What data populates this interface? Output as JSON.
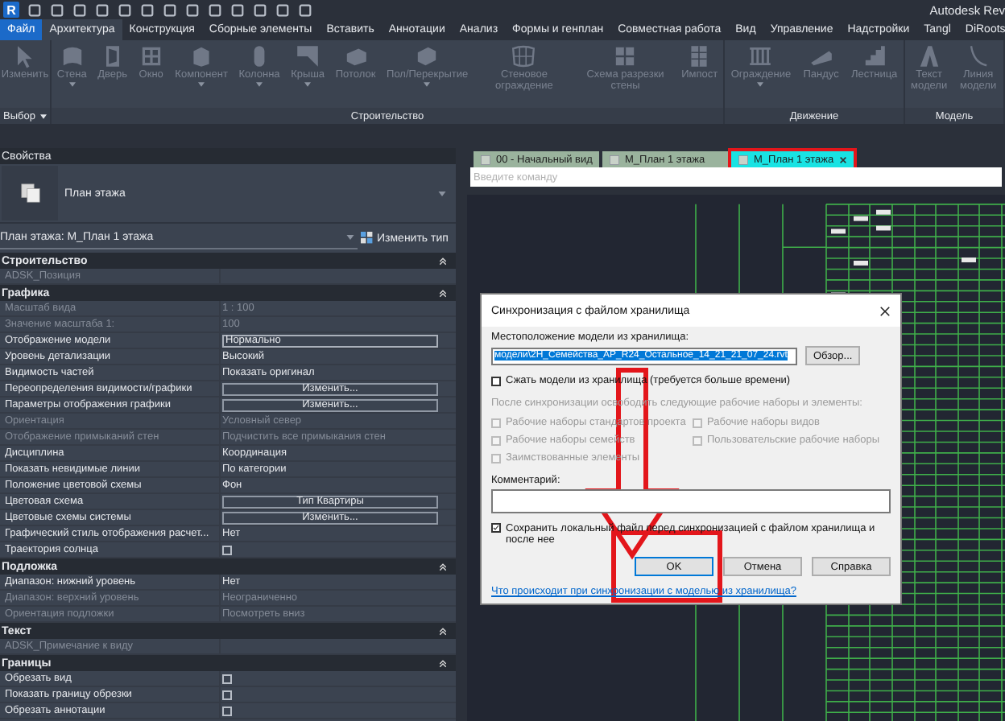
{
  "app": {
    "logo": "R",
    "title": "Autodesk Rev"
  },
  "ribbon_tabs": [
    {
      "label": "Файл",
      "kind": "menu",
      "selected": false
    },
    {
      "label": "Архитектура",
      "kind": "tab",
      "selected": true
    },
    {
      "label": "Конструкция",
      "kind": "tab",
      "selected": false
    },
    {
      "label": "Сборные элементы",
      "kind": "tab",
      "selected": false
    },
    {
      "label": "Вставить",
      "kind": "tab",
      "selected": false
    },
    {
      "label": "Аннотации",
      "kind": "tab",
      "selected": false
    },
    {
      "label": "Анализ",
      "kind": "tab",
      "selected": false
    },
    {
      "label": "Формы и генплан",
      "kind": "tab",
      "selected": false
    },
    {
      "label": "Совместная работа",
      "kind": "tab",
      "selected": false
    },
    {
      "label": "Вид",
      "kind": "tab",
      "selected": false
    },
    {
      "label": "Управление",
      "kind": "tab",
      "selected": false
    },
    {
      "label": "Надстройки",
      "kind": "tab",
      "selected": false
    },
    {
      "label": "Tangl",
      "kind": "tab",
      "selected": false
    },
    {
      "label": "DiRoots",
      "kind": "tab",
      "selected": false
    }
  ],
  "ribbon_panels": [
    {
      "label": "Выбор",
      "has_menu": true,
      "tools": [
        {
          "label": "Изменить",
          "has_menu": false
        }
      ]
    },
    {
      "label": "Строительство",
      "has_menu": false,
      "tools": [
        {
          "label": "Стена",
          "has_menu": true
        },
        {
          "label": "Дверь",
          "has_menu": false
        },
        {
          "label": "Окно",
          "has_menu": false
        },
        {
          "label": "Компонент",
          "has_menu": true
        },
        {
          "label": "Колонна",
          "has_menu": true
        },
        {
          "label": "Крыша",
          "has_menu": true
        },
        {
          "label": "Потолок",
          "has_menu": false
        },
        {
          "label": "Пол/Перекрытие",
          "has_menu": true
        },
        {
          "label": "Стеновое ограждение",
          "has_menu": false
        },
        {
          "label": "Схема разрезки стены",
          "has_menu": false
        },
        {
          "label": "Импост",
          "has_menu": false
        }
      ]
    },
    {
      "label": "Движение",
      "has_menu": false,
      "tools": [
        {
          "label": "Ограждение",
          "has_menu": true
        },
        {
          "label": "Пандус",
          "has_menu": false
        },
        {
          "label": "Лестница",
          "has_menu": false
        }
      ]
    },
    {
      "label": "Модель",
      "has_menu": false,
      "tools": [
        {
          "label": "Текст модели",
          "has_menu": false
        },
        {
          "label": "Линия модели",
          "has_menu": false
        }
      ]
    }
  ],
  "properties": {
    "title": "Свойства",
    "type_name": "План этажа",
    "instance": "План этажа: M_План 1 этажа",
    "edit_type": "Изменить тип",
    "groups": [
      {
        "label": "Строительство",
        "rows": [
          {
            "label": "ADSK_Позиция",
            "kind": "text",
            "disabled": true
          }
        ]
      },
      {
        "label": "Графика",
        "rows": [
          {
            "label": "Масштаб вида",
            "value": "1 : 100",
            "kind": "text",
            "disabled": true
          },
          {
            "label": "Значение масштаба    1:",
            "value": "100",
            "kind": "text",
            "disabled": true
          },
          {
            "label": "Отображение модели",
            "value": "Нормально",
            "kind": "field",
            "disabled": false
          },
          {
            "label": "Уровень детализации",
            "value": "Высокий",
            "kind": "text",
            "disabled": false
          },
          {
            "label": "Видимость частей",
            "value": "Показать оригинал",
            "kind": "text",
            "disabled": false
          },
          {
            "label": "Переопределения видимости/графики",
            "value": "Изменить...",
            "kind": "button",
            "disabled": false
          },
          {
            "label": "Параметры отображения графики",
            "value": "Изменить...",
            "kind": "button",
            "disabled": false
          },
          {
            "label": "Ориентация",
            "value": "Условный север",
            "kind": "text",
            "disabled": true
          },
          {
            "label": "Отображение примыканий стен",
            "value": "Подчистить все примыкания стен",
            "kind": "text",
            "disabled": true
          },
          {
            "label": "Дисциплина",
            "value": "Координация",
            "kind": "text",
            "disabled": false
          },
          {
            "label": "Показать невидимые линии",
            "value": "По категории",
            "kind": "text",
            "disabled": false
          },
          {
            "label": "Положение цветовой схемы",
            "value": "Фон",
            "kind": "text",
            "disabled": false
          },
          {
            "label": "Цветовая схема",
            "value": "Тип Квартиры",
            "kind": "button",
            "disabled": false
          },
          {
            "label": "Цветовые схемы системы",
            "value": "Изменить...",
            "kind": "button",
            "disabled": false
          },
          {
            "label": "Графический стиль отображения расчет...",
            "value": "Нет",
            "kind": "text",
            "disabled": false
          },
          {
            "label": "Траектория солнца",
            "kind": "checkbox",
            "checked": false,
            "disabled": false
          }
        ]
      },
      {
        "label": "Подложка",
        "rows": [
          {
            "label": "Диапазон: нижний уровень",
            "value": "Нет",
            "kind": "text",
            "disabled": false
          },
          {
            "label": "Диапазон: верхний уровень",
            "value": "Неограниченно",
            "kind": "text",
            "disabled": true
          },
          {
            "label": "Ориентация подложки",
            "value": "Посмотреть вниз",
            "kind": "text",
            "disabled": true
          }
        ]
      },
      {
        "label": "Текст",
        "rows": [
          {
            "label": "ADSK_Примечание к виду",
            "kind": "text",
            "disabled": true
          }
        ]
      },
      {
        "label": "Границы",
        "rows": [
          {
            "label": "Обрезать вид",
            "kind": "checkbox",
            "checked": false,
            "disabled": false
          },
          {
            "label": "Показать границу обрезки",
            "kind": "checkbox",
            "checked": false,
            "disabled": false
          },
          {
            "label": "Обрезать аннотации",
            "kind": "checkbox",
            "checked": false,
            "disabled": false
          }
        ]
      }
    ]
  },
  "view_tabs": [
    {
      "label": "00 - Начальный вид",
      "selected": false,
      "highlighted": false
    },
    {
      "label": "M_План 1 этажа",
      "selected": false,
      "highlighted": false
    },
    {
      "label": "M_План 1 этажа",
      "selected": true,
      "highlighted": true
    }
  ],
  "command_line": {
    "placeholder": "Введите команду"
  },
  "dialog": {
    "title": "Синхронизация с файлом хранилища",
    "location_label": "Местоположение модели из хранилища:",
    "location_value": "модели\\2Н_Семейства_АР_R24_Остальное_14_21_21_07_24.rvt",
    "browse": "Обзор...",
    "compress": {
      "label": "Сжать модели из хранилища (требуется больше времени)",
      "checked": false,
      "disabled": false
    },
    "release_label": "После синхронизации освободить следующие рабочие наборы и элементы:",
    "release_options": [
      {
        "label": "Рабочие наборы стандартов проекта",
        "checked": false,
        "disabled": true
      },
      {
        "label": "Рабочие наборы видов",
        "checked": false,
        "disabled": true
      },
      {
        "label": "Рабочие наборы семейств",
        "checked": false,
        "disabled": true
      },
      {
        "label": "Пользовательские рабочие наборы",
        "checked": false,
        "disabled": true
      },
      {
        "label": "Заимствованные элементы",
        "checked": false,
        "disabled": true
      }
    ],
    "comment_label": "Комментарий:",
    "save_local": {
      "label": "Сохранить локальный файл перед синхронизацией с файлом хранилища и после нее",
      "checked": true,
      "disabled": false
    },
    "buttons": [
      {
        "label": "OK",
        "default": true
      },
      {
        "label": "Отмена",
        "default": false
      },
      {
        "label": "Справка",
        "default": false
      }
    ],
    "help_link": "Что происходит при синхронизации с моделью из хранилища?"
  }
}
